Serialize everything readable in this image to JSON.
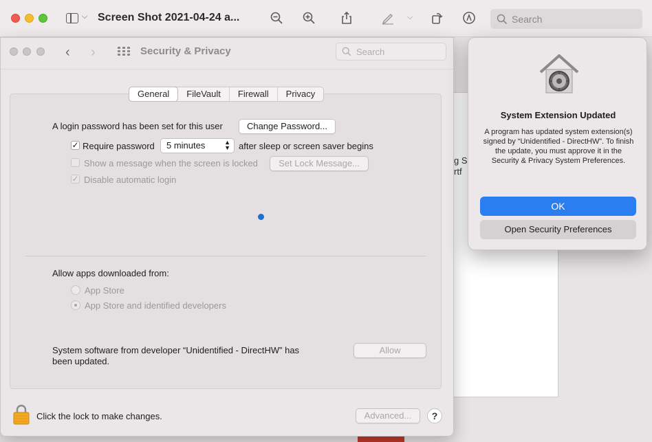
{
  "preview": {
    "title": "Screen Shot 2021-04-24 a...",
    "search_placeholder": "Search",
    "doc_fragments": [
      "g Sl",
      "rtf"
    ]
  },
  "security": {
    "window_title": "Security & Privacy",
    "search_placeholder": "Search",
    "tabs": [
      "General",
      "FileVault",
      "Firewall",
      "Privacy"
    ],
    "login_text": "A login password has been set for this user",
    "change_password": "Change Password...",
    "require_password": "Require password",
    "require_password_checked": true,
    "require_value": "5 minutes",
    "after_sleep": "after sleep or screen saver begins",
    "show_message": "Show a message when the screen is locked",
    "set_lock_message": "Set Lock Message...",
    "disable_auto_login": "Disable automatic login",
    "allow_apps_label": "Allow apps downloaded from:",
    "radio_app_store": "App Store",
    "radio_identified": "App Store and identified developers",
    "system_software_line1": "System software from developer “Unidentified - DirectHW” has",
    "system_software_line2": "been updated.",
    "allow": "Allow",
    "lock_text": "Click the lock to make changes.",
    "advanced": "Advanced...",
    "help": "?"
  },
  "dialog": {
    "title": "System Extension Updated",
    "body": "A program has updated system extension(s) signed by “Unidentified - DirectHW”. To finish the update, you must approve it in the Security & Privacy System Preferences.",
    "ok": "OK",
    "open_prefs": "Open Security Preferences"
  },
  "colors": {
    "accent": "#2a7ef0",
    "close": "#ee5b53",
    "minimize": "#f4bc2f",
    "zoom": "#5fc53e"
  }
}
